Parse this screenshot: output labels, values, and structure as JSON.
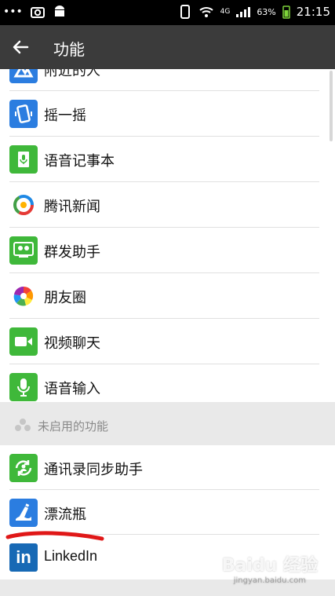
{
  "status_bar": {
    "left_icons": [
      "more-dots-icon",
      "camera-icon",
      "android-icon"
    ],
    "network": "4G",
    "battery": "63%",
    "time": "21:15"
  },
  "header": {
    "title": "功能",
    "back_icon": "back-arrow-icon"
  },
  "enabled_features": [
    {
      "label": "附近的人",
      "icon": "nearby-people-icon",
      "color": "#2b7de0"
    },
    {
      "label": "摇一摇",
      "icon": "shake-icon",
      "color": "#2b7de0"
    },
    {
      "label": "语音记事本",
      "icon": "voice-notebook-icon",
      "color": "#3fb83a"
    },
    {
      "label": "腾讯新闻",
      "icon": "tencent-news-icon",
      "color": "#ffffff"
    },
    {
      "label": "群发助手",
      "icon": "group-send-icon",
      "color": "#3fb83a"
    },
    {
      "label": "朋友圈",
      "icon": "moments-icon",
      "color": "#ffffff"
    },
    {
      "label": "视频聊天",
      "icon": "video-chat-icon",
      "color": "#3fb83a"
    },
    {
      "label": "语音输入",
      "icon": "voice-input-icon",
      "color": "#3fb83a"
    }
  ],
  "disabled_section": {
    "title": "未启用的功能"
  },
  "disabled_features": [
    {
      "label": "通讯录同步助手",
      "icon": "contacts-sync-icon",
      "color": "#3fb83a"
    },
    {
      "label": "漂流瓶",
      "icon": "drift-bottle-icon",
      "color": "#2b7de0"
    },
    {
      "label": "LinkedIn",
      "icon": "linkedin-icon",
      "color": "#1769b5"
    }
  ],
  "annotation_color": "#e01818",
  "watermark": {
    "main": "Baidu 经验",
    "sub": "jingyan.baidu.com"
  }
}
